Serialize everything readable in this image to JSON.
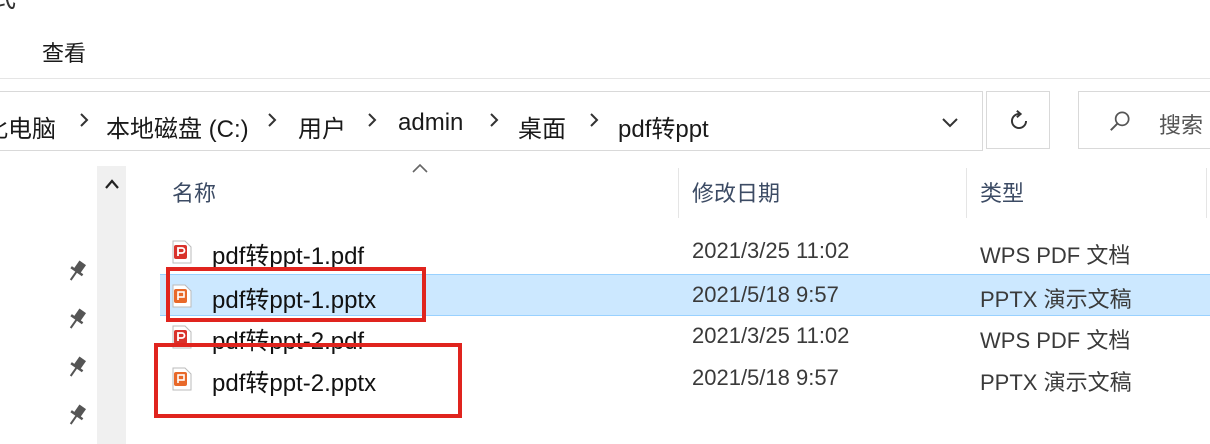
{
  "window": {
    "partial_title_glyph": "式"
  },
  "ribbon": {
    "view_tab": "查看"
  },
  "address_bar": {
    "crumbs": [
      "此电脑",
      "本地磁盘 (C:)",
      "用户",
      "admin",
      "桌面",
      "pdf转ppt"
    ]
  },
  "search": {
    "placeholder": "搜索"
  },
  "columns": {
    "name": "名称",
    "modified": "修改日期",
    "type": "类型",
    "sort": "ascending"
  },
  "files": [
    {
      "name": "pdf转ppt-1.pdf",
      "date": "2021/3/25 11:02",
      "type": "WPS PDF 文档",
      "icon": "pdf-file-icon",
      "selected": false
    },
    {
      "name": "pdf转ppt-1.pptx",
      "date": "2021/5/18 9:57",
      "type": "PPTX 演示文稿",
      "icon": "pptx-file-icon",
      "selected": true
    },
    {
      "name": "pdf转ppt-2.pdf",
      "date": "2021/3/25 11:02",
      "type": "WPS PDF 文档",
      "icon": "pdf-file-icon",
      "selected": false
    },
    {
      "name": "pdf转ppt-2.pptx",
      "date": "2021/5/18 9:57",
      "type": "PPTX 演示文稿",
      "icon": "pptx-file-icon",
      "selected": false
    }
  ],
  "colors": {
    "selection": "#cce8ff",
    "highlight_box": "#e0241e",
    "pdf_icon": "#d9322b",
    "pptx_icon": "#e8692a"
  }
}
